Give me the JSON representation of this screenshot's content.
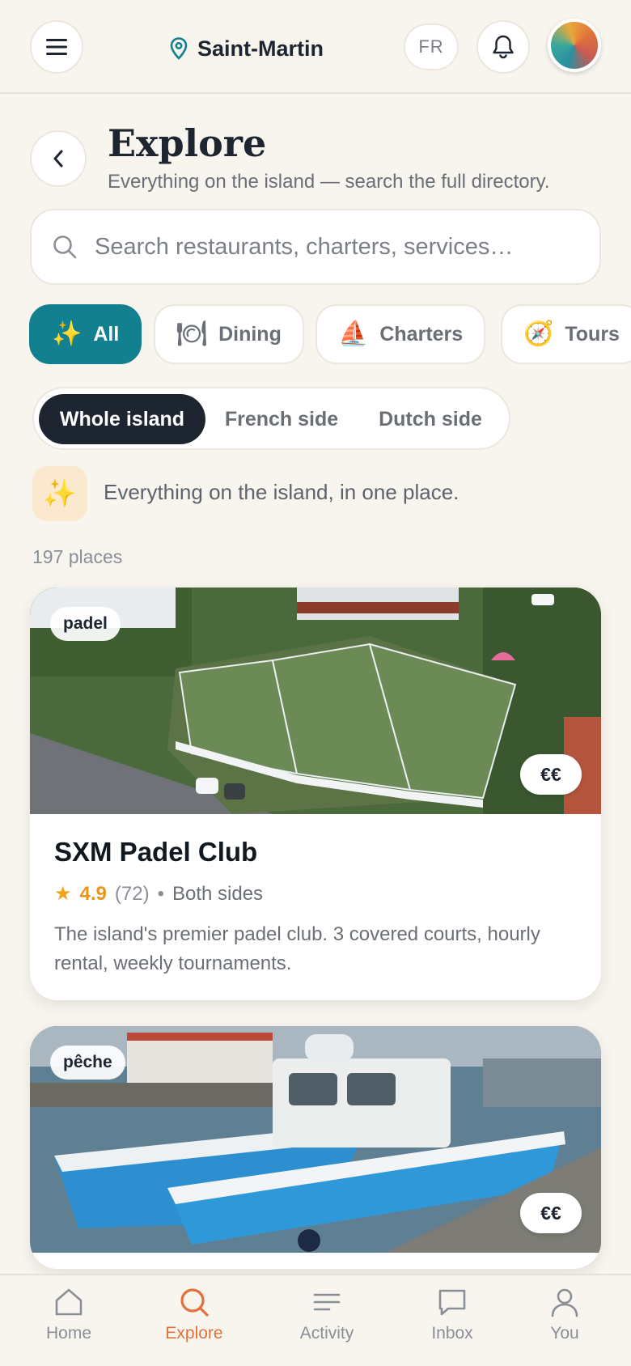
{
  "topbar": {
    "location": "Saint-Martin",
    "language": "FR",
    "icons": {
      "menu": "menu-icon",
      "location": "map-pin-icon",
      "bell": "bell-icon"
    }
  },
  "header": {
    "title": "Explore",
    "subtitle": "Everything on the island — search the full directory."
  },
  "search": {
    "value": "",
    "placeholder": "Search restaurants, charters, services…"
  },
  "categories": [
    {
      "emoji": "✨",
      "label": "All",
      "active": true
    },
    {
      "emoji": "🍽",
      "label": "Dining",
      "active": false
    },
    {
      "emoji": "⛵",
      "label": "Charters",
      "active": false
    },
    {
      "emoji": "🧭",
      "label": "Tours",
      "active": false
    }
  ],
  "regions": [
    {
      "label": "Whole island",
      "active": true
    },
    {
      "label": "French side",
      "active": false
    },
    {
      "label": "Dutch side",
      "active": false
    }
  ],
  "tagline": {
    "emoji": "✨",
    "text": "Everything on the island, in one place."
  },
  "count_label": "197 places",
  "cards": [
    {
      "tag": "padel",
      "price": "€€",
      "title": "SXM Padel Club",
      "rating": "4.9",
      "reviews": "(72)",
      "separator": "•",
      "side": "Both sides",
      "description": "The island's premier padel club. 3 covered courts, hourly rental, weekly tournaments."
    },
    {
      "tag": "pêche",
      "price": "€€"
    }
  ],
  "nav": [
    {
      "label": "Home",
      "icon": "home-icon",
      "active": false
    },
    {
      "label": "Explore",
      "icon": "search-icon",
      "active": true
    },
    {
      "label": "Activity",
      "icon": "list-icon",
      "active": false
    },
    {
      "label": "Inbox",
      "icon": "chat-icon",
      "active": false
    },
    {
      "label": "You",
      "icon": "user-icon",
      "active": false
    }
  ],
  "colors": {
    "background": "#f8f5ee",
    "accent_teal": "#13808f",
    "accent_orange": "#e2703c",
    "dark": "#1c2530",
    "star": "#f0a21a"
  }
}
